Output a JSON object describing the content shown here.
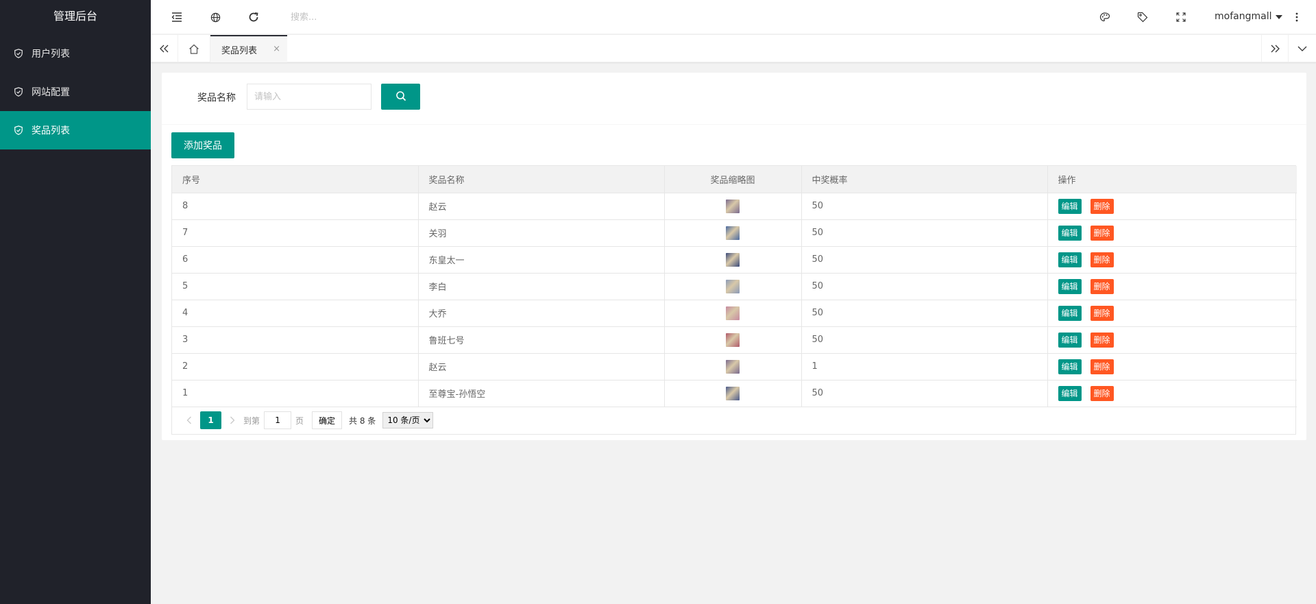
{
  "app": {
    "title": "管理后台"
  },
  "sidebar": {
    "items": [
      {
        "label": "用户列表",
        "icon": "shield-check-icon",
        "active": false
      },
      {
        "label": "网站配置",
        "icon": "shield-check-icon",
        "active": false
      },
      {
        "label": "奖品列表",
        "icon": "shield-check-icon",
        "active": true
      }
    ]
  },
  "header": {
    "search_placeholder": "搜索...",
    "username": "mofangmall",
    "icons": [
      "menu-fold-icon",
      "globe-icon",
      "refresh-icon",
      "palette-icon",
      "tag-icon",
      "fullscreen-icon",
      "more-icon"
    ]
  },
  "tabs": {
    "active": {
      "label": "奖品列表",
      "close": "×"
    }
  },
  "filter": {
    "label": "奖品名称",
    "placeholder": "请输入"
  },
  "actions": {
    "add_label": "添加奖品"
  },
  "table": {
    "headers": [
      "序号",
      "奖品名称",
      "奖品缩略图",
      "中奖概率",
      "操作"
    ],
    "rows": [
      {
        "id": "8",
        "name": "赵云",
        "rate": "50",
        "thumb_color": "#7a6a8e"
      },
      {
        "id": "7",
        "name": "关羽",
        "rate": "50",
        "thumb_color": "#4a6aa0"
      },
      {
        "id": "6",
        "name": "东皇太一",
        "rate": "50",
        "thumb_color": "#3a4a7a"
      },
      {
        "id": "5",
        "name": "李白",
        "rate": "50",
        "thumb_color": "#8a9ab8"
      },
      {
        "id": "4",
        "name": "大乔",
        "rate": "50",
        "thumb_color": "#c68aa0"
      },
      {
        "id": "3",
        "name": "鲁班七号",
        "rate": "50",
        "thumb_color": "#b05a6a"
      },
      {
        "id": "2",
        "name": "赵云",
        "rate": "1",
        "thumb_color": "#7a6a8e"
      },
      {
        "id": "1",
        "name": "至尊宝-孙悟空",
        "rate": "50",
        "thumb_color": "#4a5a8a"
      }
    ],
    "edit_label": "编辑",
    "delete_label": "删除"
  },
  "pager": {
    "current": "1",
    "goto_label": "到第",
    "goto_value": "1",
    "page_label": "页",
    "ok_label": "确定",
    "total_label": "共 8 条",
    "page_size": "10 条/页"
  },
  "colors": {
    "accent": "#009688",
    "danger": "#ff5722",
    "sidebar_bg": "#20222a"
  }
}
